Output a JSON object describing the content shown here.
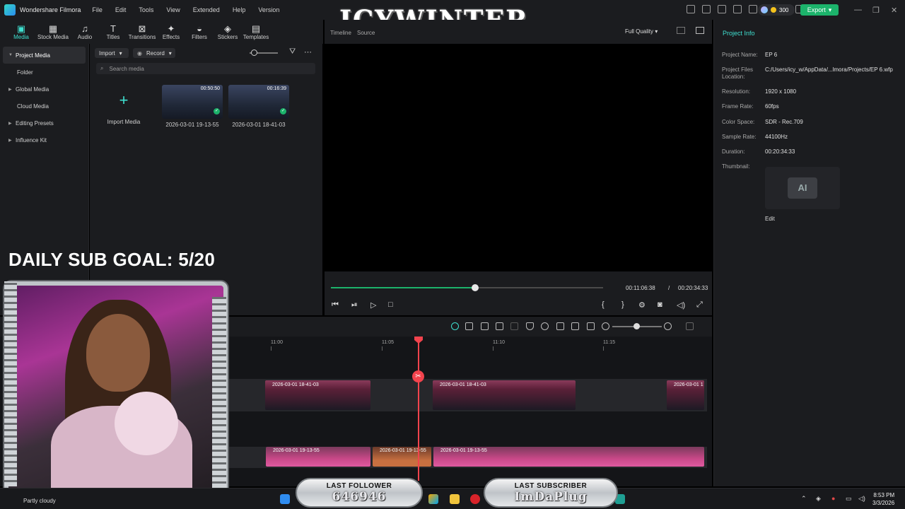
{
  "app": {
    "title": "Wondershare Filmora"
  },
  "menu": [
    "File",
    "Edit",
    "Tools",
    "View",
    "Extended",
    "Help",
    "Version"
  ],
  "credits": "300",
  "export_label": "Export",
  "overlay_brand": "ICYWINTER",
  "tabs": [
    "Media",
    "Stock Media",
    "Audio",
    "Titles",
    "Transitions",
    "Effects",
    "Filters",
    "Stickers",
    "Templates"
  ],
  "tab_icons": [
    "media-icon",
    "stock-media-icon",
    "audio-icon",
    "titles-icon",
    "transitions-icon",
    "effects-icon",
    "filters-icon",
    "stickers-icon",
    "templates-icon"
  ],
  "sidebar": [
    "Project Media",
    "Folder",
    "Global Media",
    "Cloud Media",
    "Editing Presets",
    "Influence Kit"
  ],
  "media": {
    "import_label": "Import",
    "record_label": "Record",
    "search_placeholder": "Search media",
    "import_tile": "Import Media",
    "clips": [
      {
        "name": "2026-03-01 19-13-55",
        "duration": "00:50:50"
      },
      {
        "name": "2026-03-01 18-41-03",
        "duration": "00:16:39"
      }
    ]
  },
  "goal_text": "DAILY SUB GOAL: 5/20",
  "preview": {
    "tab_timeline": "Timeline",
    "tab_source": "Source",
    "quality": "Full Quality",
    "current_time": "00:11:06:38",
    "separator": "/",
    "total_time": "00:20:34:33",
    "progress": 0.53
  },
  "project_info": {
    "title": "Project Info",
    "rows": [
      {
        "label": "Project Name:",
        "value": "EP 6"
      },
      {
        "label": "Project Files Location:",
        "value": "C:/Users/icy_w/AppData/...lmora/Projects/EP 6.wfp"
      },
      {
        "label": "Resolution:",
        "value": "1920 x 1080"
      },
      {
        "label": "Frame Rate:",
        "value": "60fps"
      },
      {
        "label": "Color Space:",
        "value": "SDR - Rec.709"
      },
      {
        "label": "Sample Rate:",
        "value": "44100Hz"
      },
      {
        "label": "Duration:",
        "value": "00:20:34:33"
      },
      {
        "label": "Thumbnail:",
        "value": ""
      }
    ],
    "thumb_text": "AI",
    "edit_label": "Edit"
  },
  "timeline": {
    "ruler": [
      "11:00",
      "11:05",
      "11:10",
      "11:15"
    ],
    "video_clips": [
      "2026-03-01 18-41-03",
      "2026-03-01 18-41-03",
      "2026-03-01 1"
    ],
    "audio_clips": [
      "2026-03-01 19-13-55",
      "2026-03-01 19-13-55",
      "2026-03-01 19-13-55"
    ]
  },
  "taskbar": {
    "weather": "Partly cloudy",
    "time": "8:53 PM",
    "date": "3/3/2026"
  },
  "stream": {
    "last_follower_label": "LAST FOLLOWER",
    "last_follower_value": "646946",
    "last_subscriber_label": "LAST SUBSCRIBER",
    "last_subscriber_value": "ImDaPlug"
  },
  "colors": {
    "accent": "#3fe0d0",
    "export": "#1cb36b",
    "playhead": "#f2434d",
    "clip": "#c84888"
  }
}
